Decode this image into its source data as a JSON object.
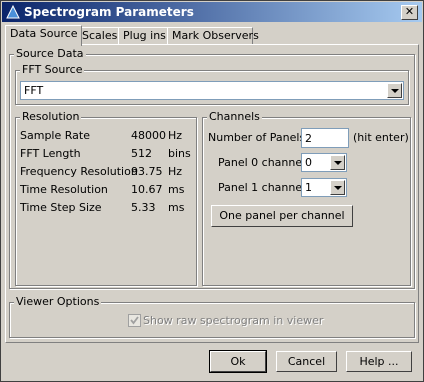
{
  "window": {
    "title": "Spectrogram Parameters",
    "close_glyph": "✕"
  },
  "tabs": [
    {
      "label": "Data Source"
    },
    {
      "label": "Scales"
    },
    {
      "label": "Plug ins"
    },
    {
      "label": "Mark Observers"
    }
  ],
  "source_data": {
    "legend": "Source Data",
    "fft_source": {
      "legend": "FFT Source",
      "selected": "FFT"
    }
  },
  "resolution": {
    "legend": "Resolution",
    "rows": [
      {
        "label": "Sample Rate",
        "value": "48000",
        "unit": "Hz"
      },
      {
        "label": "FFT Length",
        "value": "512",
        "unit": "bins"
      },
      {
        "label": "Frequency Resolution",
        "value": "93.75",
        "unit": "Hz"
      },
      {
        "label": "Time Resolution",
        "value": "10.67",
        "unit": "ms"
      },
      {
        "label": "Time Step Size",
        "value": "5.33",
        "unit": "ms"
      }
    ]
  },
  "channels": {
    "legend": "Channels",
    "num_panels_label": "Number of Panels",
    "num_panels_value": "2",
    "hint": "(hit enter)",
    "panel0_label": "Panel 0 channel",
    "panel0_value": "0",
    "panel1_label": "Panel 1 channel",
    "panel1_value": "1",
    "one_panel_button": "One panel per channel"
  },
  "viewer_options": {
    "legend": "Viewer Options",
    "show_raw_label": "Show raw spectrogram in viewer",
    "show_raw_checked": true
  },
  "footer": {
    "ok": "Ok",
    "cancel": "Cancel",
    "help": "Help ..."
  }
}
